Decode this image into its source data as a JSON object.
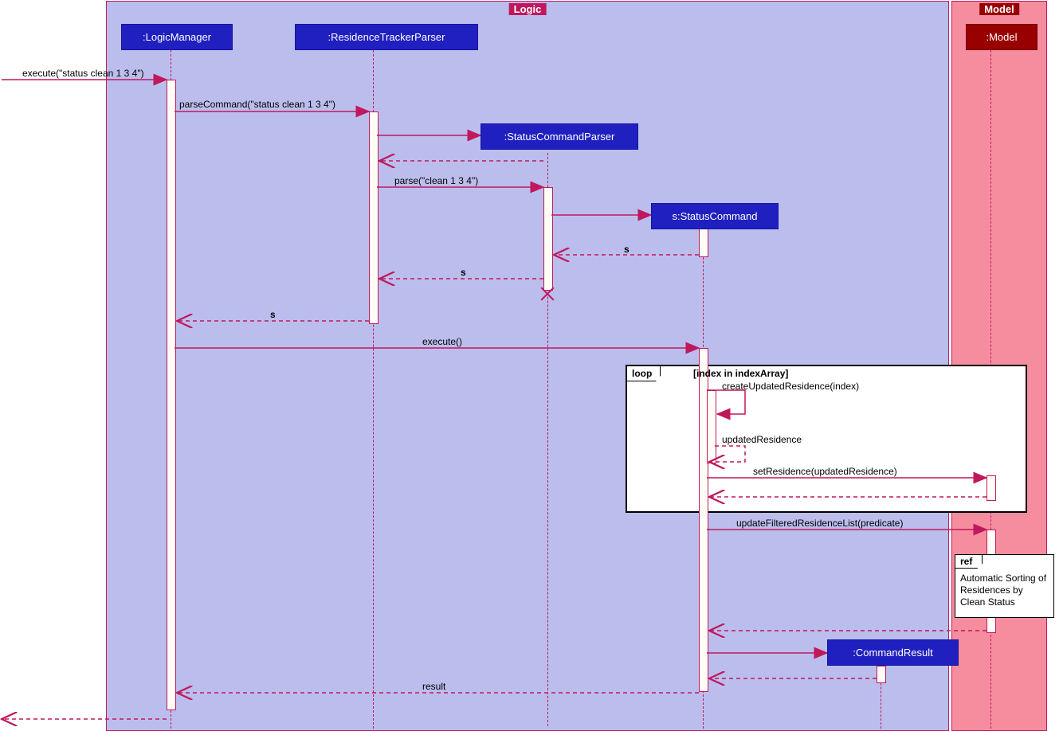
{
  "frames": {
    "logic_title": "Logic",
    "model_title": "Model"
  },
  "participants": {
    "logic_manager": ":LogicManager",
    "parser": ":ResidenceTrackerParser",
    "status_parser": ":StatusCommandParser",
    "status_command": "s:StatusCommand",
    "model": ":Model",
    "command_result": ":CommandResult"
  },
  "messages": {
    "m1": "execute(\"status clean 1 3 4\")",
    "m2": "parseCommand(\"status clean 1 3 4\")",
    "m3": "parse(\"clean 1 3 4\")",
    "m4": "s",
    "m5": "s",
    "m6": "s",
    "m7": "execute()",
    "m8": "createUpdatedResidence(index)",
    "m9": "updatedResidence",
    "m10": "setResidence(updatedResidence)",
    "m11": "updateFilteredResidenceList(predicate)",
    "m12": "result"
  },
  "loop": {
    "label": "loop",
    "guard": "[index in indexArray]"
  },
  "ref": {
    "label": "ref",
    "text": "Automatic Sorting of Residences by Clean Status"
  },
  "chart_data": {
    "type": "uml-sequence-diagram",
    "frames": [
      {
        "name": "Logic",
        "participants": [
          "LogicManager",
          "ResidenceTrackerParser",
          "StatusCommandParser",
          "StatusCommand",
          "CommandResult"
        ]
      },
      {
        "name": "Model",
        "participants": [
          "Model"
        ]
      }
    ],
    "participants": [
      {
        "id": "LogicManager",
        "label": ":LogicManager"
      },
      {
        "id": "ResidenceTrackerParser",
        "label": ":ResidenceTrackerParser"
      },
      {
        "id": "StatusCommandParser",
        "label": ":StatusCommandParser",
        "created": true,
        "destroyed": true
      },
      {
        "id": "StatusCommand",
        "label": "s:StatusCommand",
        "created": true
      },
      {
        "id": "Model",
        "label": ":Model"
      },
      {
        "id": "CommandResult",
        "label": ":CommandResult",
        "created": true
      }
    ],
    "messages": [
      {
        "from": "external",
        "to": "LogicManager",
        "label": "execute(\"status clean 1 3 4\")",
        "type": "sync"
      },
      {
        "from": "LogicManager",
        "to": "ResidenceTrackerParser",
        "label": "parseCommand(\"status clean 1 3 4\")",
        "type": "sync"
      },
      {
        "from": "ResidenceTrackerParser",
        "to": "StatusCommandParser",
        "label": "",
        "type": "create"
      },
      {
        "from": "StatusCommandParser",
        "to": "ResidenceTrackerParser",
        "label": "",
        "type": "return"
      },
      {
        "from": "ResidenceTrackerParser",
        "to": "StatusCommandParser",
        "label": "parse(\"clean 1 3 4\")",
        "type": "sync"
      },
      {
        "from": "StatusCommandParser",
        "to": "StatusCommand",
        "label": "",
        "type": "create"
      },
      {
        "from": "StatusCommand",
        "to": "StatusCommandParser",
        "label": "s",
        "type": "return"
      },
      {
        "from": "StatusCommandParser",
        "to": "ResidenceTrackerParser",
        "label": "s",
        "type": "return"
      },
      {
        "from": "StatusCommandParser",
        "to": null,
        "label": "",
        "type": "destroy"
      },
      {
        "from": "ResidenceTrackerParser",
        "to": "LogicManager",
        "label": "s",
        "type": "return"
      },
      {
        "from": "LogicManager",
        "to": "StatusCommand",
        "label": "execute()",
        "type": "sync"
      },
      {
        "fragment": "loop",
        "guard": "[index in indexArray]",
        "messages": [
          {
            "from": "StatusCommand",
            "to": "StatusCommand",
            "label": "createUpdatedResidence(index)",
            "type": "self"
          },
          {
            "from": "StatusCommand",
            "to": "StatusCommand",
            "label": "updatedResidence",
            "type": "self-return"
          },
          {
            "from": "StatusCommand",
            "to": "Model",
            "label": "setResidence(updatedResidence)",
            "type": "sync"
          },
          {
            "from": "Model",
            "to": "StatusCommand",
            "label": "",
            "type": "return"
          }
        ]
      },
      {
        "from": "StatusCommand",
        "to": "Model",
        "label": "updateFilteredResidenceList(predicate)",
        "type": "sync"
      },
      {
        "fragment": "ref",
        "at": "Model",
        "label": "Automatic Sorting of Residences by Clean Status"
      },
      {
        "from": "Model",
        "to": "StatusCommand",
        "label": "",
        "type": "return"
      },
      {
        "from": "StatusCommand",
        "to": "CommandResult",
        "label": "",
        "type": "create"
      },
      {
        "from": "CommandResult",
        "to": "StatusCommand",
        "label": "",
        "type": "return"
      },
      {
        "from": "StatusCommand",
        "to": "LogicManager",
        "label": "result",
        "type": "return"
      },
      {
        "from": "LogicManager",
        "to": "external",
        "label": "",
        "type": "return"
      }
    ]
  }
}
